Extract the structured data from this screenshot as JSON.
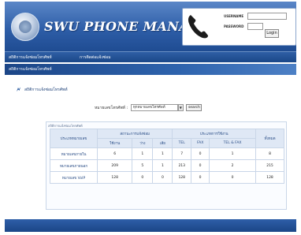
{
  "header": {
    "title": "SWU PHONE MANAGEMENT",
    "username_label": "USERNAME",
    "password_label": "PASSWORD",
    "login_button": "Login"
  },
  "nav": {
    "items": [
      "สถิติการแจ้งซ่อมโทรศัพท์",
      "การติดต่อแจ้งซ่อม"
    ],
    "breadcrumb": "สถิติการแจ้งซ่อมโทรศัพท์"
  },
  "page": {
    "heading": "สถิติการแจ้งซ่อมโทรศัพท์"
  },
  "filter": {
    "label": "หมายเลขโทรศัพท์ :",
    "selected": "ทุกหมายเลขโทรศัพท์",
    "button": "search"
  },
  "table": {
    "caption": "สถิติการแจ้งซ่อมโทรศัพท์",
    "head_type": "ประเภทหมายเลข",
    "group_status": "สถานะการแจ้งซ่อม",
    "group_usage": "ประเภทการใช้งาน",
    "head_total": "ทั้งหมด",
    "sub_status": [
      "ใช้งาน",
      "ว่าง",
      "เสีย"
    ],
    "sub_usage": [
      "TEL",
      "FAX",
      "TEL & FAX"
    ],
    "rows": [
      {
        "type": "หมายเลขภายใน",
        "cells": [
          "6",
          "1",
          "1",
          "7",
          "0",
          "1",
          "8"
        ]
      },
      {
        "type": "หมายเลขภายนอก",
        "cells": [
          "209",
          "5",
          "1",
          "213",
          "0",
          "2",
          "215"
        ]
      },
      {
        "type": "หมายเลข VoIP",
        "cells": [
          "128",
          "0",
          "0",
          "128",
          "0",
          "0",
          "128"
        ]
      }
    ]
  }
}
